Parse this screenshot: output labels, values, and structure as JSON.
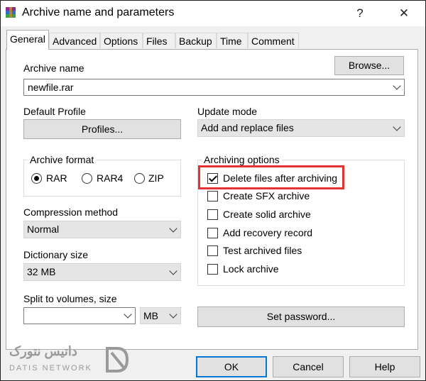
{
  "window": {
    "title": "Archive name and parameters",
    "help_glyph": "?",
    "close_glyph": "✕"
  },
  "tabs": [
    {
      "label": "General",
      "active": true
    },
    {
      "label": "Advanced"
    },
    {
      "label": "Options"
    },
    {
      "label": "Files"
    },
    {
      "label": "Backup"
    },
    {
      "label": "Time"
    },
    {
      "label": "Comment"
    }
  ],
  "archive_name": {
    "label": "Archive name",
    "value": "newfile.rar",
    "browse_label": "Browse..."
  },
  "default_profile": {
    "label": "Default Profile",
    "button_label": "Profiles..."
  },
  "update_mode": {
    "label": "Update mode",
    "value": "Add and replace files"
  },
  "archive_format": {
    "label": "Archive format",
    "options": [
      {
        "label": "RAR",
        "selected": true
      },
      {
        "label": "RAR4",
        "selected": false
      },
      {
        "label": "ZIP",
        "selected": false
      }
    ]
  },
  "archiving_options": {
    "label": "Archiving options",
    "items": [
      {
        "label": "Delete files after archiving",
        "checked": true
      },
      {
        "label": "Create SFX archive",
        "checked": false
      },
      {
        "label": "Create solid archive",
        "checked": false
      },
      {
        "label": "Add recovery record",
        "checked": false
      },
      {
        "label": "Test archived files",
        "checked": false
      },
      {
        "label": "Lock archive",
        "checked": false
      }
    ]
  },
  "compression_method": {
    "label": "Compression method",
    "value": "Normal"
  },
  "dictionary_size": {
    "label": "Dictionary size",
    "value": "32 MB"
  },
  "split_volumes": {
    "label": "Split to volumes, size",
    "value": "",
    "unit": "MB"
  },
  "set_password_label": "Set password...",
  "footer": {
    "ok": "OK",
    "cancel": "Cancel",
    "help": "Help"
  },
  "watermark": {
    "text_fa": "داتیس نتورک",
    "text_en": "DATIS NETWORK"
  },
  "colors": {
    "highlight": "#e53232",
    "default_button_border": "#0078d7"
  }
}
